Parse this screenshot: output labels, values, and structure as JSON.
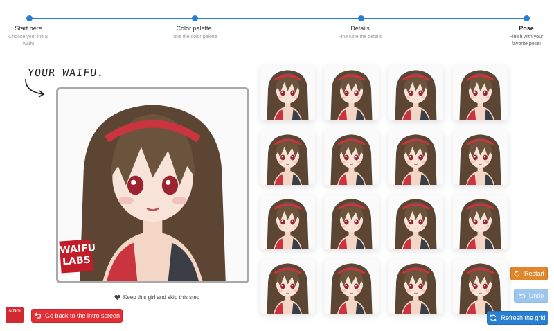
{
  "steps": [
    {
      "title": "Start here",
      "subtitle": "Choose your initial waifu"
    },
    {
      "title": "Color palette",
      "subtitle": "Tune the color palette"
    },
    {
      "title": "Details",
      "subtitle": "Fine tune the details"
    },
    {
      "title": "Pose",
      "subtitle": "Finish with your favorite pose!"
    }
  ],
  "left": {
    "heading": "YOUR WAIFU.",
    "logo_text": "WAIFU LABS",
    "keep_label": "Keep this girl and skip this step"
  },
  "footer": {
    "brand_text": "SIZIGI",
    "back_label": "Go back to the intro screen"
  },
  "actions": {
    "restart_label": "Restart",
    "undo_label": "Undo",
    "refresh_label": "Refresh the grid"
  },
  "colors": {
    "accent": "#2a7fd4",
    "restart": "#e0872b",
    "back": "#e33037",
    "hair": "#5c4633",
    "ribbon": "#c9343f"
  },
  "grid": {
    "rows": 4,
    "cols": 4,
    "tile_count": 16
  }
}
